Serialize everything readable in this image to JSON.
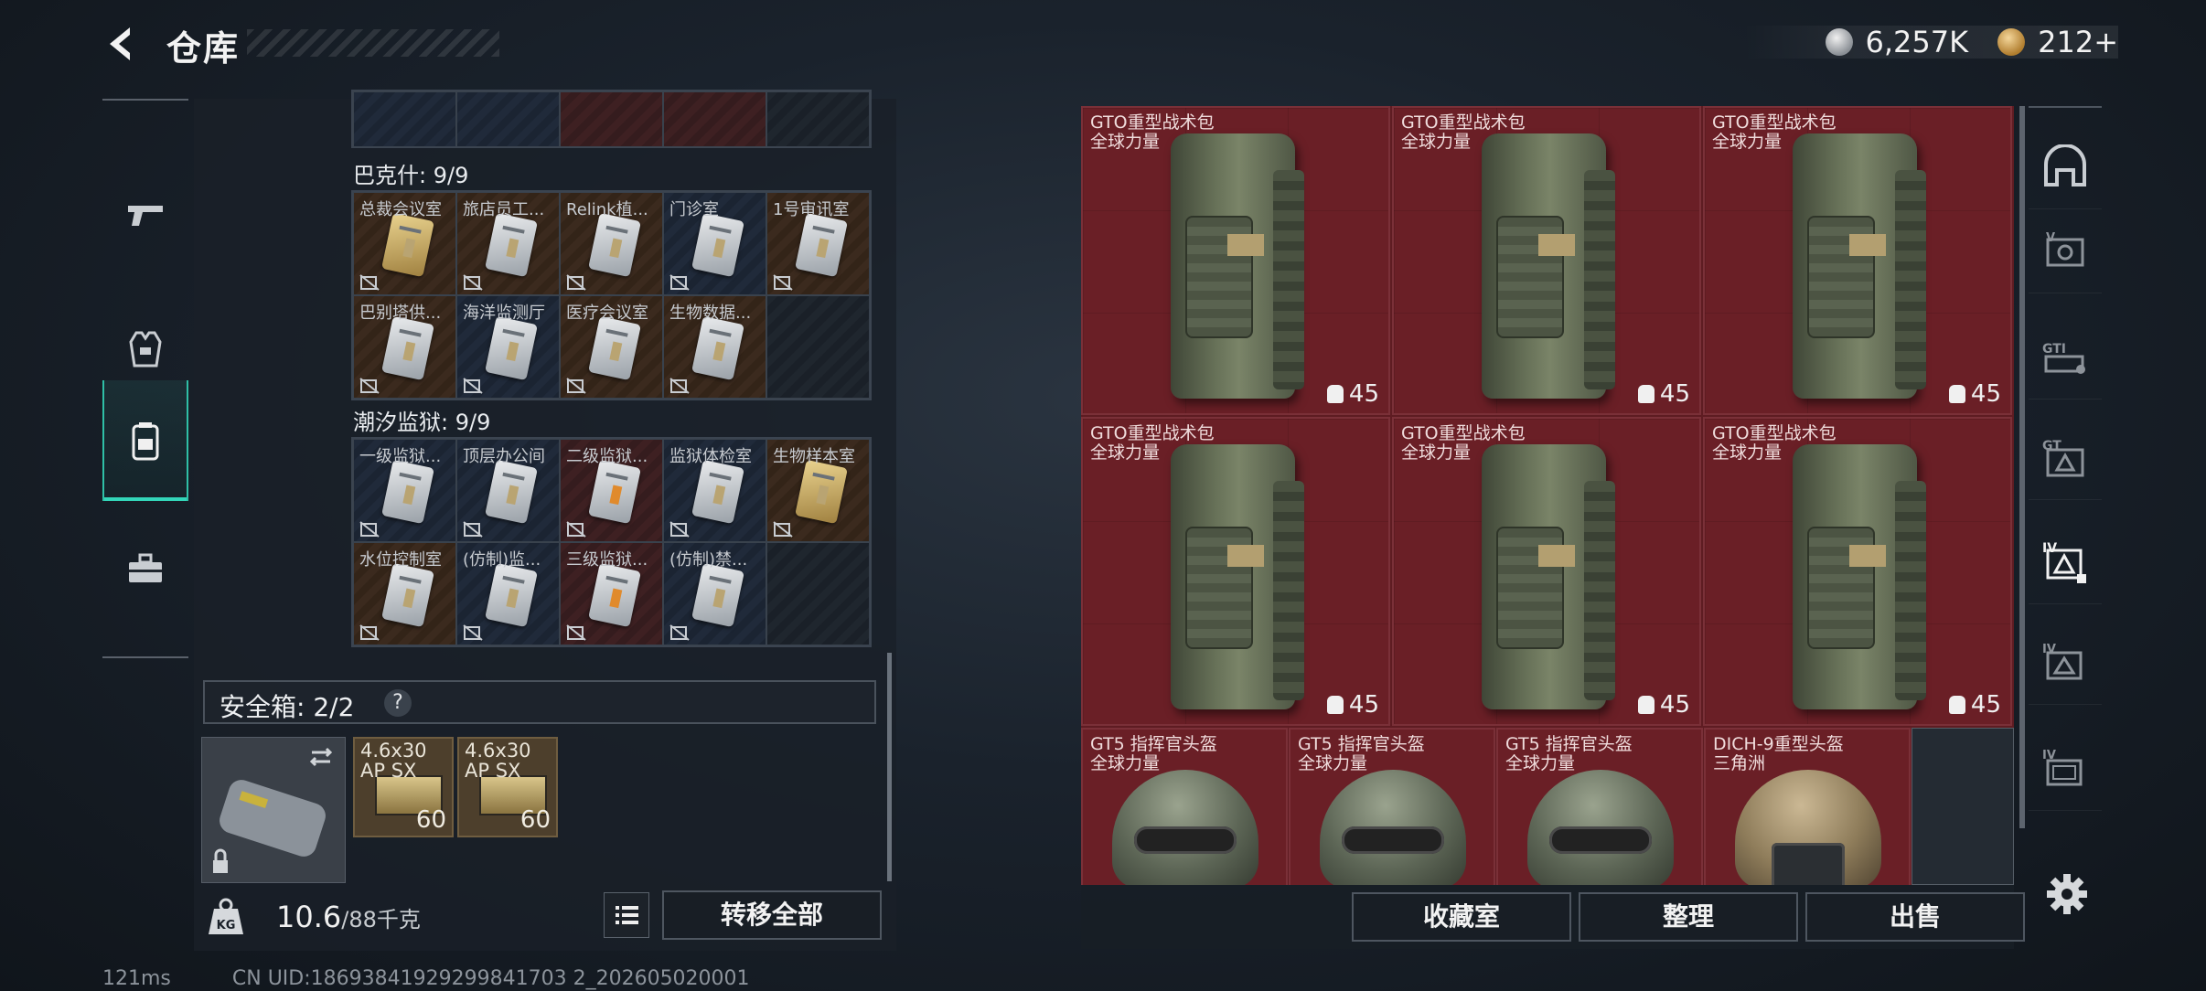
{
  "header": {
    "title": "仓库",
    "currency_silver": "6,257K",
    "currency_gold": "212+"
  },
  "sidebar": {
    "items": [
      {
        "name": "weapons",
        "icon": "pistol-icon"
      },
      {
        "name": "equipment",
        "icon": "armor-icon"
      },
      {
        "name": "containers",
        "icon": "backpack-icon"
      },
      {
        "name": "items",
        "icon": "toolbox-icon"
      }
    ],
    "active_index": 2
  },
  "key_groups": [
    {
      "label": "巴克什: 9/9",
      "cells": [
        {
          "name": "总裁会议室",
          "rarity": "orange"
        },
        {
          "name": "旅店员工...",
          "rarity": "orange"
        },
        {
          "name": "Relink植...",
          "rarity": "orange"
        },
        {
          "name": "门诊室",
          "rarity": "blue"
        },
        {
          "name": "1号审讯室",
          "rarity": "orange"
        },
        {
          "name": "巴别塔供...",
          "rarity": "orange"
        },
        {
          "name": "海洋监测厅",
          "rarity": "blue"
        },
        {
          "name": "医疗会议室",
          "rarity": "orange"
        },
        {
          "name": "生物数据...",
          "rarity": "orange"
        },
        {
          "name": "",
          "rarity": "empty"
        }
      ]
    },
    {
      "label": "潮汐监狱: 9/9",
      "cells": [
        {
          "name": "一级监狱...",
          "rarity": "blue"
        },
        {
          "name": "顶层办公间",
          "rarity": "blue"
        },
        {
          "name": "二级监狱...",
          "rarity": "red"
        },
        {
          "name": "监狱体检室",
          "rarity": "blue"
        },
        {
          "name": "生物样本室",
          "rarity": "orange"
        },
        {
          "name": "水位控制室",
          "rarity": "orange"
        },
        {
          "name": "(仿制)监...",
          "rarity": "blue"
        },
        {
          "name": "三级监狱...",
          "rarity": "red"
        },
        {
          "name": "(仿制)禁...",
          "rarity": "blue"
        },
        {
          "name": "",
          "rarity": "empty"
        }
      ]
    }
  ],
  "safe_box": {
    "title": "安全箱: 2/2",
    "help": "?",
    "ammo": [
      {
        "line1": "4.6x30",
        "line2": "AP SX",
        "qty": "60"
      },
      {
        "line1": "4.6x30",
        "line2": "AP SX",
        "qty": "60"
      }
    ]
  },
  "bottom_left": {
    "weight_value": "10.6",
    "weight_total": "/88千克",
    "transfer_all": "转移全部"
  },
  "stash": {
    "backpacks": [
      {
        "name": "GTO重型战术包",
        "faction": "全球力量",
        "capacity": "45"
      },
      {
        "name": "GTO重型战术包",
        "faction": "全球力量",
        "capacity": "45"
      },
      {
        "name": "GTO重型战术包",
        "faction": "全球力量",
        "capacity": "45"
      },
      {
        "name": "GTO重型战术包",
        "faction": "全球力量",
        "capacity": "45"
      },
      {
        "name": "GTO重型战术包",
        "faction": "全球力量",
        "capacity": "45"
      },
      {
        "name": "GTO重型战术包",
        "faction": "全球力量",
        "capacity": "45"
      }
    ],
    "helmets": [
      {
        "name": "GT5 指挥官头盔",
        "faction": "全球力量"
      },
      {
        "name": "GT5 指挥官头盔",
        "faction": "全球力量"
      },
      {
        "name": "GT5 指挥官头盔",
        "faction": "全球力量"
      },
      {
        "name": "DICH-9重型头盔",
        "faction": "三角洲"
      }
    ]
  },
  "bottom_right": {
    "collection_button": "收藏室",
    "sort_button": "整理",
    "sell_button": "出售"
  },
  "rail": {
    "items": [
      {
        "label": "",
        "icon": "home-icon"
      },
      {
        "label": "V",
        "icon": "tier-5-icon"
      },
      {
        "label": "G",
        "icon": "gun-case-icon"
      },
      {
        "label": "G",
        "icon": "gear-case-icon"
      },
      {
        "label": "IV",
        "icon": "tier-4-selected-icon"
      },
      {
        "label": "IV",
        "icon": "tier-4-icon"
      },
      {
        "label": "IV",
        "icon": "tier-4-alt-icon"
      }
    ]
  },
  "footer": {
    "ping": "121ms",
    "uid": "CN UID:18693841929299841703 2_202605020001"
  },
  "colors": {
    "accent": "#33d6b9",
    "stash_red": "#6a1f26",
    "panel": "#1a2028"
  }
}
